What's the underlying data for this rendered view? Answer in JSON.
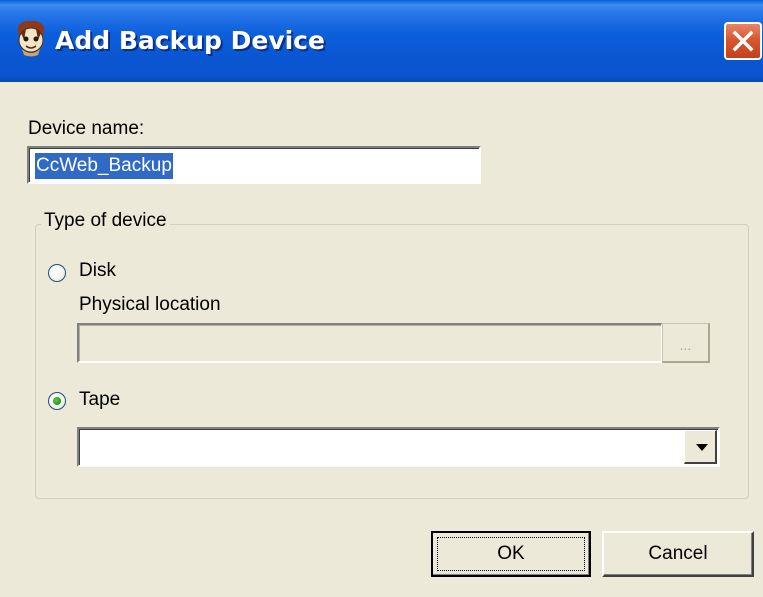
{
  "dialog": {
    "title": "Add Backup Device",
    "close_symbol": "✕"
  },
  "device_name": {
    "label": "Device name:",
    "value": "CcWeb_Backup"
  },
  "type_group": {
    "legend": "Type of device",
    "disk": {
      "label": "Disk",
      "selected": false,
      "physical_location_label": "Physical location",
      "physical_location_value": "",
      "browse_label": "..."
    },
    "tape": {
      "label": "Tape",
      "selected": true,
      "value": ""
    }
  },
  "buttons": {
    "ok": "OK",
    "cancel": "Cancel"
  },
  "colors": {
    "titlebar": "#0a56d2",
    "face": "#ece9d8",
    "selection": "#316ac5",
    "close": "#d9572e"
  },
  "icons": {
    "title_icon": "sql-server-app-icon",
    "close": "close-icon",
    "dropdown": "chevron-down-icon"
  }
}
